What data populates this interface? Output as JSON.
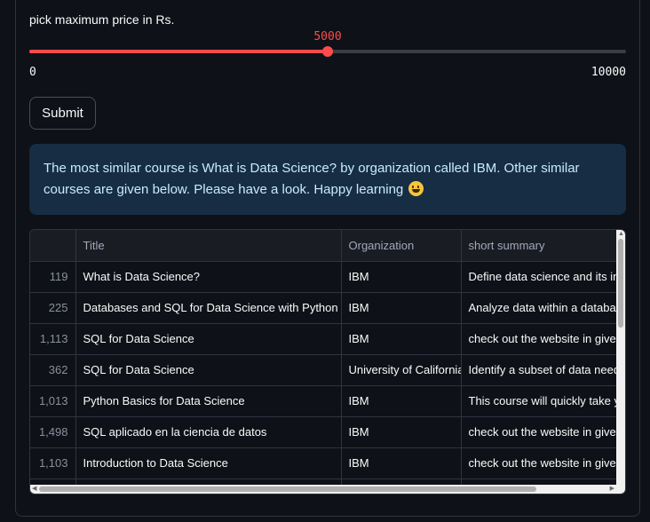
{
  "slider": {
    "label": "pick maximum price in Rs.",
    "value_text": "5000",
    "min_text": "0",
    "max_text": "10000",
    "value": 5000,
    "min": 0,
    "max": 10000
  },
  "submit_label": "Submit",
  "info_message": "The most similar course is What is Data Science? by organization called IBM. Other similar courses are given below. Please have a look. Happy learning",
  "table": {
    "columns": [
      "",
      "Title",
      "Organization",
      "short summary"
    ],
    "rows": [
      {
        "idx": "119",
        "title": "What is Data Science?",
        "org": "IBM",
        "summary": "Define data science and its imp"
      },
      {
        "idx": "225",
        "title": "Databases and SQL for Data Science with Python",
        "org": "IBM",
        "summary": "Analyze data within a database"
      },
      {
        "idx": "1,113",
        "title": "SQL for Data Science",
        "org": "IBM",
        "summary": "check out the website in given"
      },
      {
        "idx": "362",
        "title": "SQL for Data Science",
        "org": "University of California",
        "summary": "Identify a subset of data needed"
      },
      {
        "idx": "1,013",
        "title": "Python Basics for Data Science",
        "org": "IBM",
        "summary": "This course will quickly take you"
      },
      {
        "idx": "1,498",
        "title": "SQL aplicado en la  ciencia de datos",
        "org": "IBM",
        "summary": "check out the website in given"
      },
      {
        "idx": "1,103",
        "title": "Introduction to Data Science",
        "org": "IBM",
        "summary": "check out the website in given"
      },
      {
        "idx": "",
        "title": "",
        "org": "",
        "summary": ""
      }
    ]
  },
  "colors": {
    "accent": "#ff4b4b",
    "info_bg": "#172d43",
    "info_text": "#c7ebff",
    "background": "#0e1117"
  },
  "icons": {
    "emoji": "grinning-face-emoji"
  }
}
